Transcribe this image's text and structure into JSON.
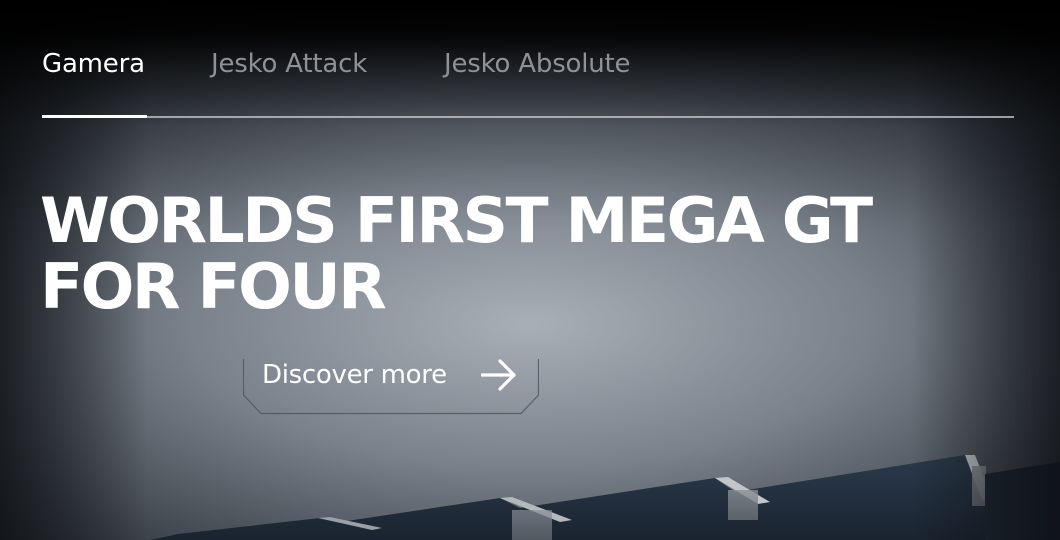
{
  "tabs": [
    {
      "label": "Gamera",
      "active": true
    },
    {
      "label": "Jesko Attack",
      "active": false
    },
    {
      "label": "Jesko Absolute",
      "active": false
    }
  ],
  "hero": {
    "headline_line1": "WORLDS FIRST MEGA GT",
    "headline_line2": "FOR FOUR",
    "cta_label": "Discover more",
    "cta_icon": "arrow-right-icon"
  },
  "colors": {
    "active_tab": "#ffffff",
    "inactive_tab": "#8e9196",
    "headline": "#ffffff",
    "sky": "#aab1b8"
  }
}
